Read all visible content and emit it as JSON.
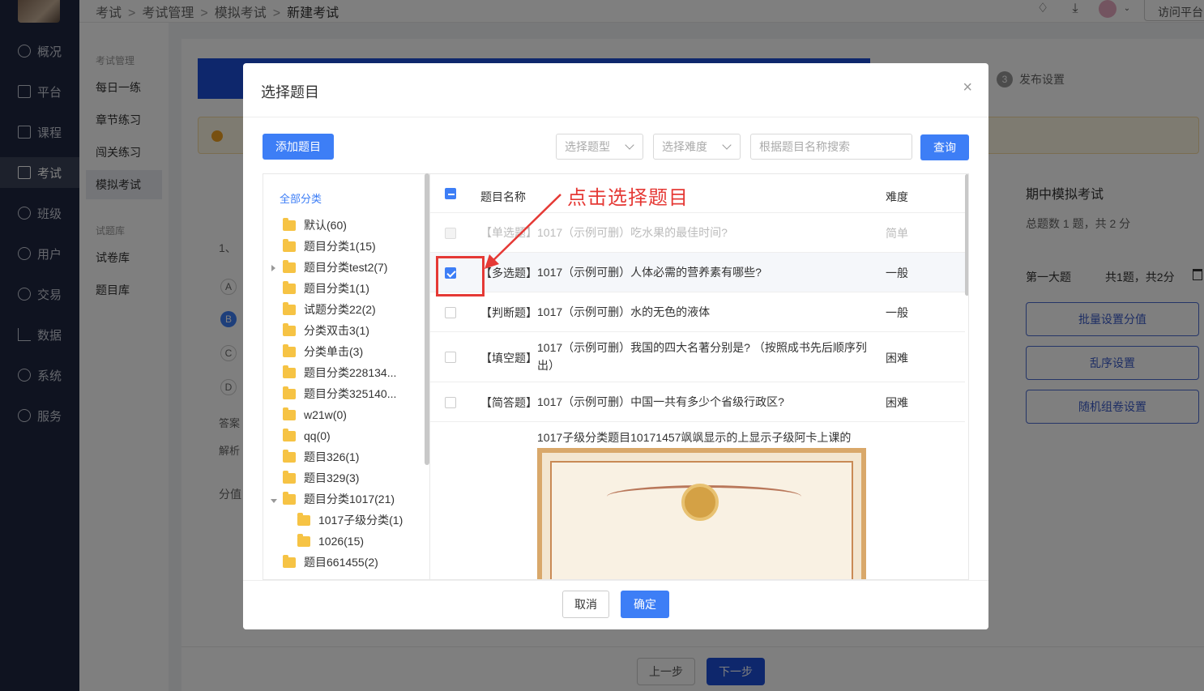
{
  "breadcrumb": [
    "考试",
    "考试管理",
    "模拟考试",
    "新建考试"
  ],
  "header": {
    "visit_label": "访问平台"
  },
  "sidebar": {
    "items": [
      {
        "label": "概况",
        "icon": "clock-icon"
      },
      {
        "label": "平台",
        "icon": "store-icon"
      },
      {
        "label": "课程",
        "icon": "book-icon"
      },
      {
        "label": "考试",
        "icon": "exam-icon"
      },
      {
        "label": "班级",
        "icon": "class-icon"
      },
      {
        "label": "用户",
        "icon": "user-icon"
      },
      {
        "label": "交易",
        "icon": "trade-icon"
      },
      {
        "label": "数据",
        "icon": "chart-icon"
      },
      {
        "label": "系统",
        "icon": "gear-icon"
      },
      {
        "label": "服务",
        "icon": "service-icon"
      }
    ]
  },
  "subnav": {
    "group1": "考试管理",
    "items1": [
      "每日一练",
      "章节练习",
      "闯关练习",
      "模拟考试"
    ],
    "group2": "试题库",
    "items2": [
      "试卷库",
      "题目库"
    ]
  },
  "steps": {
    "step3_num": "3",
    "step3_label": "发布设置"
  },
  "bg_left": {
    "opt_a": "A",
    "opt_b": "B",
    "opt_c": "C",
    "opt_d": "D",
    "answer": "答案",
    "analysis": "解析",
    "score": "分值",
    "q1": "1、"
  },
  "right_panel": {
    "title": "期中模拟考试",
    "summary": "总题数 1 题，共 2 分",
    "section": "第一大题",
    "section_stats": "共1题，共2分",
    "btn_batch": "批量设置分值",
    "btn_shuffle": "乱序设置",
    "btn_random": "随机组卷设置"
  },
  "bottom": {
    "prev": "上一步",
    "next": "下一步"
  },
  "modal": {
    "title": "选择题目",
    "add_button": "添加题目",
    "type_placeholder": "选择题型",
    "difficulty_placeholder": "选择难度",
    "search_placeholder": "根据题目名称搜索",
    "query_button": "查询",
    "tree_root": "全部分类",
    "tree": [
      "默认(60)",
      "题目分类1(15)",
      "题目分类test2(7)",
      "题目分类1(1)",
      "试题分类22(2)",
      "分类双击3(1)",
      "分类单击(3)",
      "题目分类228134...",
      "题目分类325140...",
      "w21w(0)",
      "qq(0)",
      "题目326(1)",
      "题目329(3)",
      "题目分类1017(21)",
      "1017子级分类(1)",
      "1026(15)",
      "题目661455(2)"
    ],
    "columns": {
      "name": "题目名称",
      "difficulty": "难度"
    },
    "rows": [
      {
        "type": "【单选题】",
        "text": "1017（示例可删）吃水果的最佳时间?",
        "difficulty": "简单"
      },
      {
        "type": "【多选题】",
        "text": "1017（示例可删）人体必需的营养素有哪些?",
        "difficulty": "一般"
      },
      {
        "type": "【判断题】",
        "text": "1017（示例可删）水的无色的液体",
        "difficulty": "一般"
      },
      {
        "type": "【填空题】",
        "text": "1017（示例可删）我国的四大名著分别是?  （按照成书先后顺序列出）",
        "difficulty": "困难"
      },
      {
        "type": "【简答题】",
        "text": "1017（示例可删）中国一共有多少个省级行政区?",
        "difficulty": "困难"
      },
      {
        "type": "",
        "text": "1017子级分类题目10171457飒飒显示的上显示子级阿卡上课的",
        "difficulty": ""
      }
    ],
    "cancel": "取消",
    "confirm": "确定"
  },
  "annotation": {
    "text": "点击选择题目",
    "color": "#e53935"
  },
  "colors": {
    "primary": "#3d7ef6",
    "sidebar": "#1f2740",
    "step": "#1d4ed8"
  }
}
